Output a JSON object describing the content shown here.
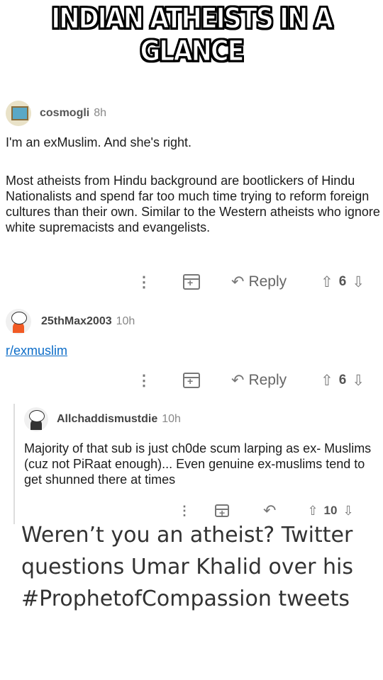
{
  "meme_title": "INDIAN ATHEISTS IN A GLANCE",
  "comments": [
    {
      "username": "cosmogli",
      "time": "8h",
      "line1": "I'm an exMuslim. And she's right.",
      "body": "Most atheists from Hindu background are bootlickers of Hindu Nationalists and spend far too much time trying to reform foreign cultures than their own. Similar to the Western atheists who ignore white supremacists and evangelists.",
      "reply_label": "Reply",
      "votes": "6"
    },
    {
      "username": "25thMax2003",
      "time": "10h",
      "link": "r/exmuslim",
      "reply_label": "Reply",
      "votes": "6"
    },
    {
      "username": "Allchaddismustdie",
      "time": "10h",
      "body": "Majority of that sub is just ch0de scum larping as ex- Muslims (cuz not PiRaat enough)... Even genuine ex-muslims tend to get shunned there at times",
      "votes": "10"
    }
  ],
  "headline": "Weren’t you an atheist? Twitter questions Umar Khalid over his #ProphetofCompassion tweets",
  "icons": [
    "more-dots-icon",
    "award-icon",
    "reply-icon",
    "upvote-icon",
    "downvote-icon"
  ]
}
